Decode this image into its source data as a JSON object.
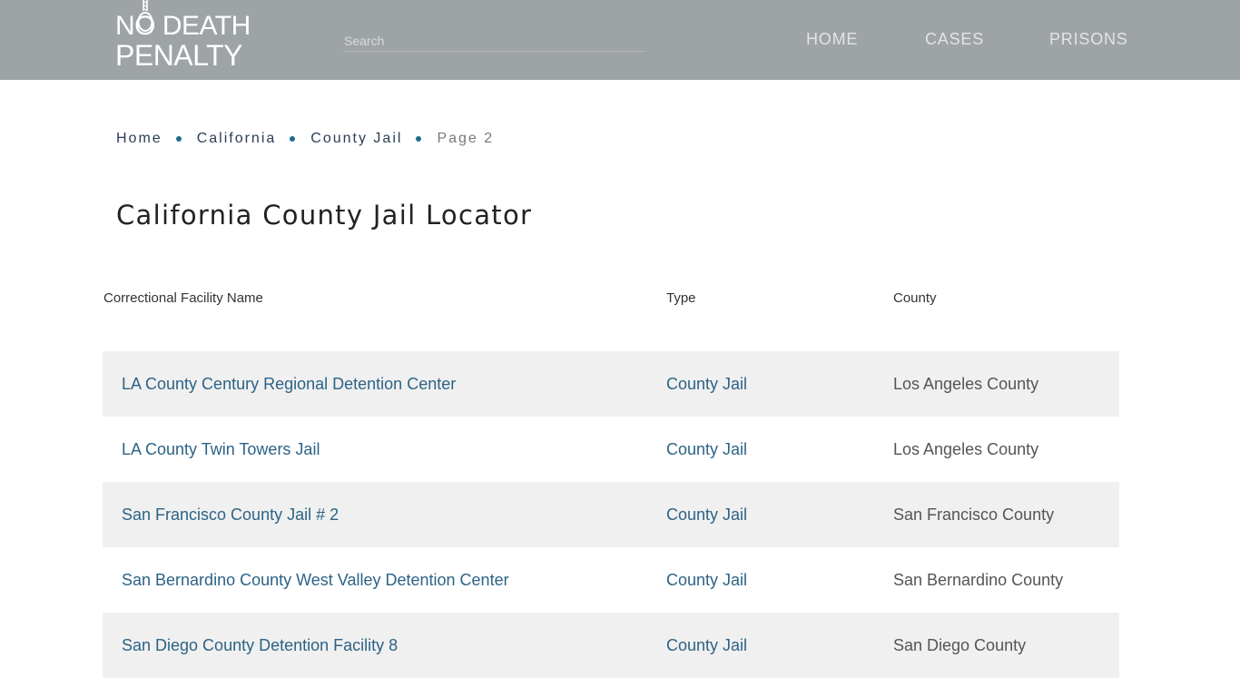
{
  "header": {
    "logo": {
      "line1": "NO DEATH",
      "line2": "PENALTY"
    },
    "search": {
      "placeholder": "Search",
      "value": ""
    },
    "nav": [
      {
        "label": "HOME"
      },
      {
        "label": "CASES"
      },
      {
        "label": "PRISONS"
      }
    ]
  },
  "breadcrumb": [
    {
      "label": "Home"
    },
    {
      "label": "California"
    },
    {
      "label": "County Jail"
    },
    {
      "label": "Page 2"
    }
  ],
  "page": {
    "title": "California County Jail Locator"
  },
  "table": {
    "columns": [
      "Correctional Facility Name",
      "Type",
      "County"
    ],
    "rows": [
      {
        "name": "LA County Century Regional Detention Center",
        "type": "County Jail",
        "county": "Los Angeles County"
      },
      {
        "name": "LA County Twin Towers Jail",
        "type": "County Jail",
        "county": "Los Angeles County"
      },
      {
        "name": "San Francisco County Jail # 2",
        "type": "County Jail",
        "county": "San Francisco County"
      },
      {
        "name": "San Bernardino County West Valley Detention Center",
        "type": "County Jail",
        "county": "San Bernardino County"
      },
      {
        "name": "San Diego County Detention Facility 8",
        "type": "County Jail",
        "county": "San Diego County"
      }
    ]
  },
  "colors": {
    "header_bg": "#9ea3a5",
    "link": "#2c6386",
    "bullet": "#1e6b8c",
    "row_alt": "#f0f0f0"
  }
}
